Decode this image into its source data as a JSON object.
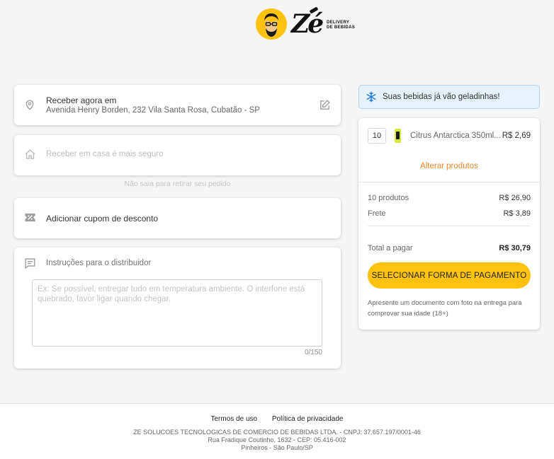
{
  "brand": {
    "name": "Zé",
    "tagline_line1": "DELIVERY",
    "tagline_line2": "DE BEBIDAS",
    "color_yellow": "#ffc20e"
  },
  "address": {
    "title": "Receber agora em",
    "line": "Avenida Henry Borden, 232 Vila Santa Rosa, Cubatão - SP",
    "icon": "location-pin-icon",
    "edit_icon": "edit-icon"
  },
  "home_delivery": {
    "label": "Receber em casa é mais seguro",
    "note": "Não saia para retirar seu pedido",
    "icon": "home-icon"
  },
  "coupon": {
    "label": "Adicionar cupom de desconto",
    "icon": "coupon-icon"
  },
  "instructions": {
    "title": "Instruções para o distribuidor",
    "placeholder": "Ex: Se possível, entregar tudo em temperatura ambiente. O interfone está quebrado, favor ligar quando chegar.",
    "value": "",
    "counter": "0/150",
    "icon": "message-icon"
  },
  "banner": {
    "text": "Suas bebidas já vão geladinhas!",
    "icon": "snowflake-icon",
    "color": "#1976d2"
  },
  "cart": {
    "items": [
      {
        "quantity": "10",
        "name": "Citrus Antarctica 350ml...",
        "price": "R$ 2,69"
      }
    ],
    "change_link": "Alterar produtos",
    "link_color": "#e8882b",
    "products_label": "10 produtos",
    "products_value": "R$ 26,90",
    "shipping_label": "Frete",
    "shipping_value": "R$ 3,89",
    "total_label": "Total a pagar",
    "total_value": "R$ 30,79",
    "pay_button": "SELECIONAR FORMA DE PAGAMENTO",
    "notice": "Apresente um documento com foto na entrega para comprovar sua idade (18+)"
  },
  "footer": {
    "terms": "Termos de uso",
    "privacy": "Política de privacidade",
    "company": "ZE SOLUCOES TECNOLOGICAS DE COMERCIO DE BEBIDAS LTDA. - CNPJ: 37.657.197/0001-46",
    "street": "Rua Fradique Coutinho, 1632 - CEP: 05.416-002",
    "city": "Pinheiros - São Paulo/SP"
  }
}
